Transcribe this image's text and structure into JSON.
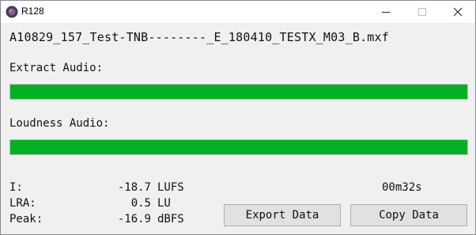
{
  "window": {
    "title": "R128",
    "controls": {
      "minimize_icon": "minimize-icon",
      "maximize_icon": "maximize-icon",
      "close_icon": "close-icon"
    }
  },
  "file": {
    "name": "A10829_157_Test-TNB--------_E_180410_TESTX_M03_B.mxf"
  },
  "extract": {
    "label": "Extract Audio:",
    "progress": 1.0
  },
  "loudness": {
    "label": "Loudness Audio:",
    "progress": 1.0
  },
  "stats": [
    {
      "key": "I:",
      "value": "-18.7",
      "unit": "LUFS"
    },
    {
      "key": "LRA:",
      "value": "0.5",
      "unit": "LU"
    },
    {
      "key": "Peak:",
      "value": "-16.9",
      "unit": "dBFS"
    }
  ],
  "timer": "00m32s",
  "buttons": {
    "export": "Export Data",
    "copy": "Copy Data"
  },
  "colors": {
    "progress_fill": "#06b025",
    "window_bg": "#f0f0f0",
    "button_bg": "#e1e1e1"
  }
}
